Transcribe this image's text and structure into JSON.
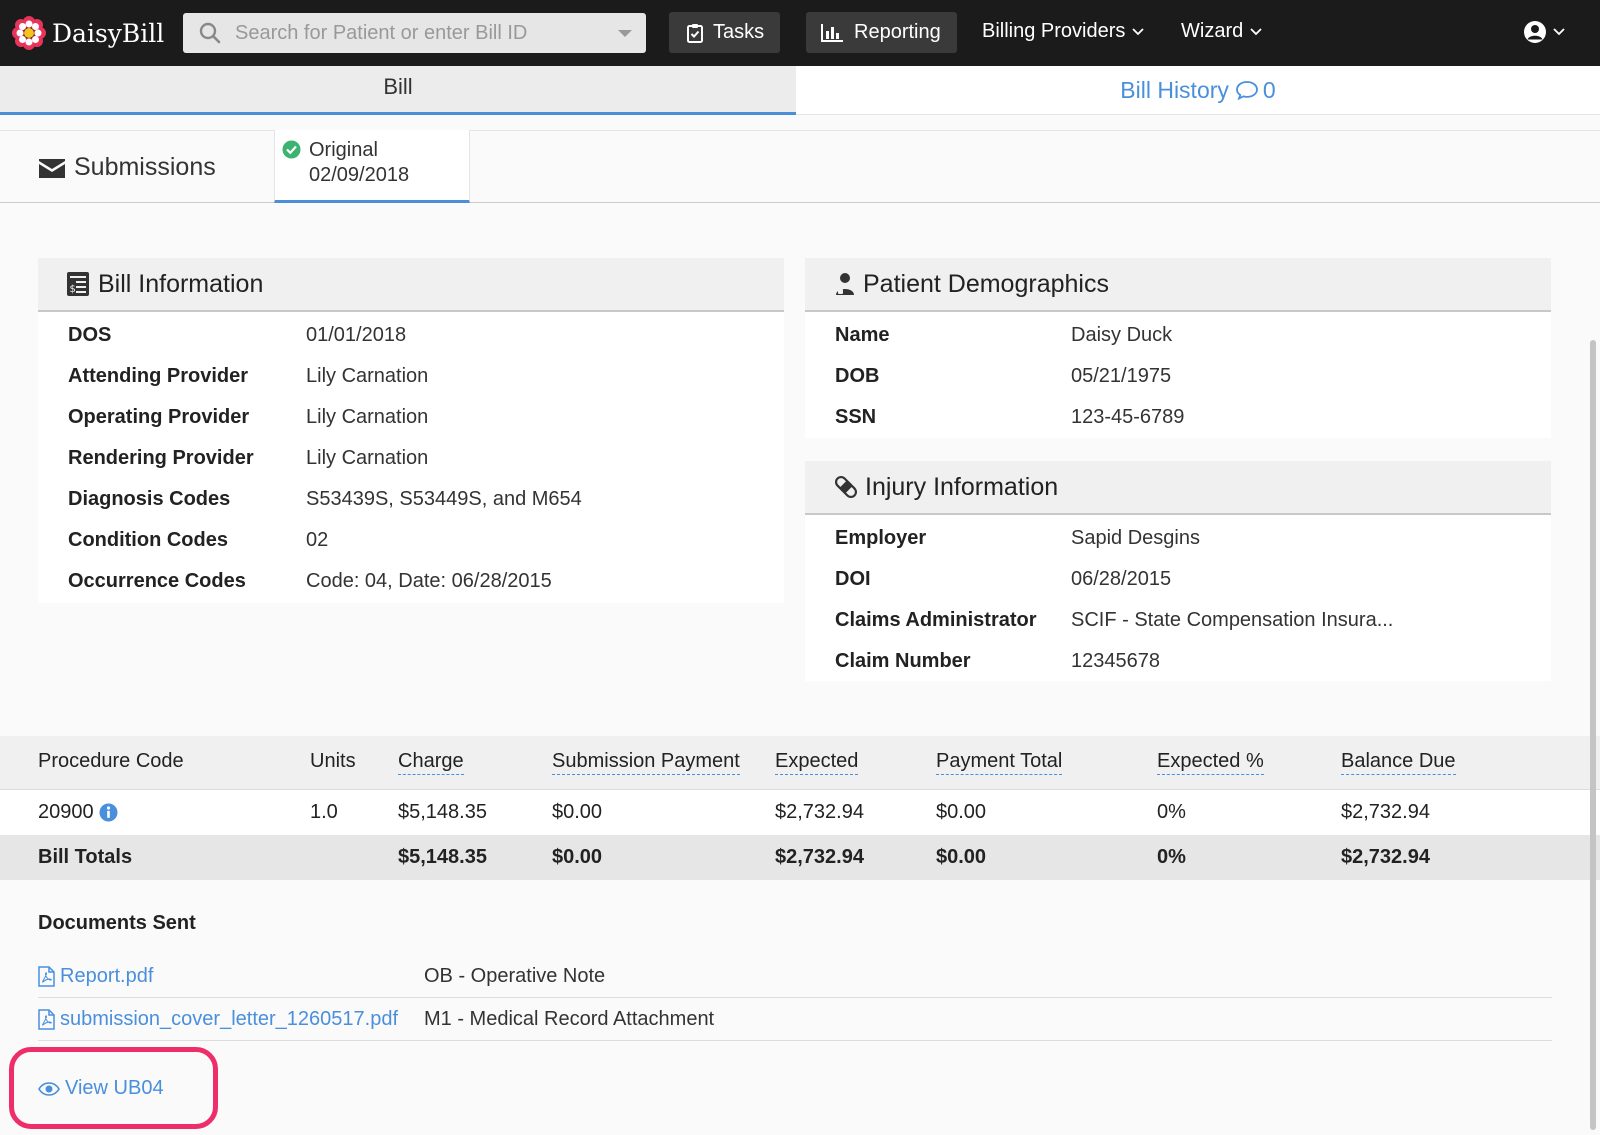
{
  "navbar": {
    "brand": "DaisyBill",
    "search_placeholder": "Search for Patient or enter Bill ID",
    "tasks": "Tasks",
    "reporting": "Reporting",
    "billing_providers": "Billing Providers",
    "wizard": "Wizard"
  },
  "tabs": {
    "bill": "Bill",
    "history": "Bill History",
    "history_count": "0"
  },
  "submissions": {
    "title": "Submissions",
    "tab_label": "Original",
    "tab_date": "02/09/2018"
  },
  "bill_info": {
    "title": "Bill Information",
    "rows": [
      {
        "label": "DOS",
        "value": "01/01/2018"
      },
      {
        "label": "Attending Provider",
        "value": "Lily Carnation"
      },
      {
        "label": "Operating Provider",
        "value": "Lily Carnation"
      },
      {
        "label": "Rendering Provider",
        "value": "Lily Carnation"
      },
      {
        "label": "Diagnosis Codes",
        "value": "S53439S, S53449S, and M654"
      },
      {
        "label": "Condition Codes",
        "value": "02"
      },
      {
        "label": "Occurrence Codes",
        "value": "Code: 04, Date: 06/28/2015"
      }
    ]
  },
  "patient": {
    "title": "Patient Demographics",
    "rows": [
      {
        "label": "Name",
        "value": "Daisy Duck"
      },
      {
        "label": "DOB",
        "value": "05/21/1975"
      },
      {
        "label": "SSN",
        "value": "123-45-6789"
      }
    ]
  },
  "injury": {
    "title": "Injury Information",
    "rows": [
      {
        "label": "Employer",
        "value": "Sapid Desgins"
      },
      {
        "label": "DOI",
        "value": "06/28/2015"
      },
      {
        "label": "Claims Administrator",
        "value": "SCIF - State Compensation Insura..."
      },
      {
        "label": "Claim Number",
        "value": "12345678"
      }
    ]
  },
  "procedures": {
    "headers": [
      "Procedure Code",
      "Units",
      "Charge",
      "Submission Payment",
      "Expected",
      "Payment Total",
      "Expected %",
      "Balance Due"
    ],
    "rows": [
      [
        "20900",
        "1.0",
        "$5,148.35",
        "$0.00",
        "$2,732.94",
        "$0.00",
        "0%",
        "$2,732.94"
      ]
    ],
    "totals": [
      "Bill Totals",
      "",
      "$5,148.35",
      "$0.00",
      "$2,732.94",
      "$0.00",
      "0%",
      "$2,732.94"
    ]
  },
  "documents": {
    "title": "Documents Sent",
    "items": [
      {
        "file": "Report.pdf",
        "type": "OB - Operative Note"
      },
      {
        "file": "submission_cover_letter_1260517.pdf",
        "type": "M1 - Medical Record Attachment"
      }
    ],
    "view_label": "View UB04"
  },
  "colors": {
    "link": "#4a8fdc",
    "navbar": "#1b1b1b",
    "success": "#3cb371",
    "highlight": "#ee2e6b"
  }
}
